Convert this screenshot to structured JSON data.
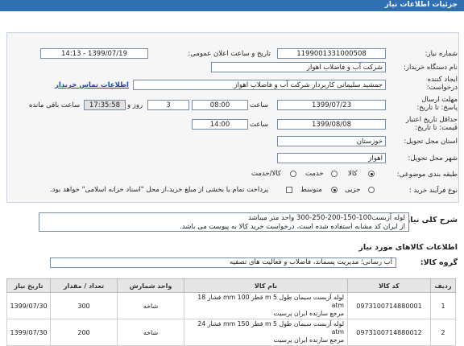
{
  "page": {
    "header": "جزئیات اطلاعات نیاز"
  },
  "form": {
    "need_number_label": "شماره نیاز:",
    "need_number": "1199001331000508",
    "announce_label": "تاریخ و ساعت اعلان عمومی:",
    "announce_value": "1399/07/19 - 14:13",
    "buyer_label": "نام دستگاه خریدار:",
    "buyer_value": "شرکت آب و فاضلاب اهواز",
    "creator_label": "ایجاد کننده درخواست:",
    "creator_value": "جمشید سلیمانی کاربردار شرکت آب و فاضلاب اهواز",
    "contact_link": "اطلاعات تماس خریدار",
    "reply_deadline_label": "مهلت ارسال پاسخ: تا تاریخ:",
    "reply_date": "1399/07/23",
    "time_label": "ساعت",
    "reply_time": "08:00",
    "days_value": "3",
    "days_label": "روز و",
    "remaining_time": "17:35:58",
    "remaining_label": "ساعت باقی مانده",
    "validity_label": "حداقل تاریخ اعتبار قیمت: تا تاریخ:",
    "validity_date": "1399/08/08",
    "validity_time": "14:00",
    "province_label": "استان محل تحویل:",
    "province_value": "خوزستان",
    "city_label": "شهر محل تحویل:",
    "city_value": "اهواز",
    "category_label": "طبقه بندی موضوعی:",
    "category_options": [
      "کالا",
      "خدمت",
      "کالا/خدمت"
    ],
    "category_selected": "کالا",
    "process_label": "نوع فرآیند خرید :",
    "process_options": [
      "جزیی",
      "متوسط"
    ],
    "process_selected": "متوسط",
    "payment_note": "پرداخت تمام یا بخشی از مبلغ خرید،از محل \"اسناد خزانه اسلامی\" خواهد بود."
  },
  "description": {
    "label": "شرح کلی نیاز:",
    "line1": "لوله آزبست100-150-200-250-300      واحد متر میباشد",
    "line2": "از ایران کد مشابه استفاده شده است، درخواست خرید کالا به پیوست می باشد."
  },
  "goods": {
    "section_title": "اطلاعات کالاهای مورد نیاز",
    "group_label": "گروه کالا:",
    "group_value": "آب رسانی؛ مدیریت پسماند، فاضلاب و فعالیت های تصفیه",
    "columns": [
      "ردیف",
      "کد کالا",
      "نام کالا",
      "واحد شمارش",
      "تعداد / مقدار",
      "تاریخ نیاز"
    ],
    "rows": [
      {
        "row": "1",
        "code": "0973100714880001",
        "name": "لوله آزبست سیمان طول 5 m قطر 100 mm فشار 18 atm",
        "name2": "مرجع سازنده ایران پرسیت",
        "unit": "شاخه",
        "qty": "300",
        "date": "1399/07/30"
      },
      {
        "row": "2",
        "code": "0973100714880012",
        "name": "لوله آزبست سیمان طول 5 m قطر 150 mm فشار 24 atm",
        "name2": "مرجع سازنده ایران پرسیت",
        "unit": "شاخه",
        "qty": "200",
        "date": "1399/07/30"
      }
    ]
  },
  "colors": {
    "header_bg": "#2f6fb2",
    "link": "#1a4db5"
  }
}
